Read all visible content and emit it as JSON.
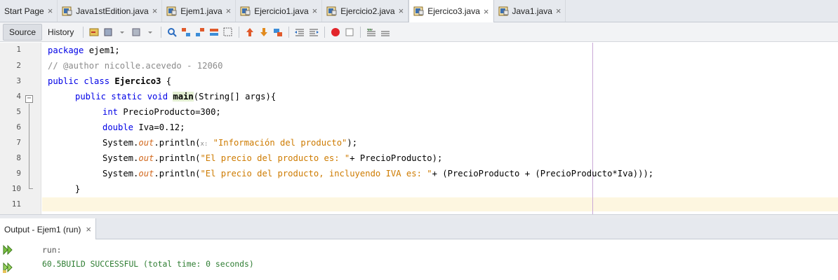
{
  "tabs": [
    {
      "label": "Start Page",
      "active": false
    },
    {
      "label": "Java1stEdition.java",
      "active": false
    },
    {
      "label": "Ejem1.java",
      "active": false
    },
    {
      "label": "Ejercicio1.java",
      "active": false
    },
    {
      "label": "Ejercicio2.java",
      "active": false
    },
    {
      "label": "Ejercico3.java",
      "active": true
    },
    {
      "label": "Java1.java",
      "active": false
    }
  ],
  "close_glyph": "×",
  "toolbar": {
    "source_label": "Source",
    "history_label": "History"
  },
  "editor": {
    "line_numbers": [
      "1",
      "2",
      "3",
      "4",
      "5",
      "6",
      "7",
      "8",
      "9",
      "10",
      "11"
    ],
    "fold_collapse_glyph": "−",
    "code": {
      "l1_kw": "package",
      "l1_rest": " ejem1;",
      "l2_comment": "// @author nicolle.acevedo - 12060",
      "l3_kw": "public class",
      "l3_name": "Ejercico3",
      "l3_rest": " {",
      "l4_kw": "public static void",
      "l4_method": "main",
      "l4_rest": "(String[] args){",
      "l5_kw": "int",
      "l5_rest": " PrecioProducto=300;",
      "l6_kw": "double",
      "l6_rest": " Iva=0.12;",
      "sys": "System.",
      "out": "out",
      "println": ".println(",
      "l7_hint": "x:",
      "l7_str": "\"Información del producto\"",
      "l7_end": ");",
      "l8_str": "\"El precio del producto es: \"",
      "l8_end": "+ PrecioProducto);",
      "l9_str": "\"El precio del producto, incluyendo IVA es: \"",
      "l9_end": "+ (PrecioProducto + (PrecioProducto*Iva)));",
      "l10": "}"
    }
  },
  "output": {
    "tab_label": "Output - Ejem1 (run)",
    "lines": [
      "run:",
      "60.5BUILD SUCCESSFUL (total time: 0 seconds)"
    ]
  },
  "icons": {
    "java_file": "java-file-icon",
    "rerun": "rerun-icon",
    "rerun_alt": "rerun-with-arguments-icon"
  },
  "colors": {
    "keyword": "#0000e6",
    "comment": "#8c8c8c",
    "string": "#ce7b00",
    "field": "#d2691e",
    "success": "#2e7d32"
  }
}
